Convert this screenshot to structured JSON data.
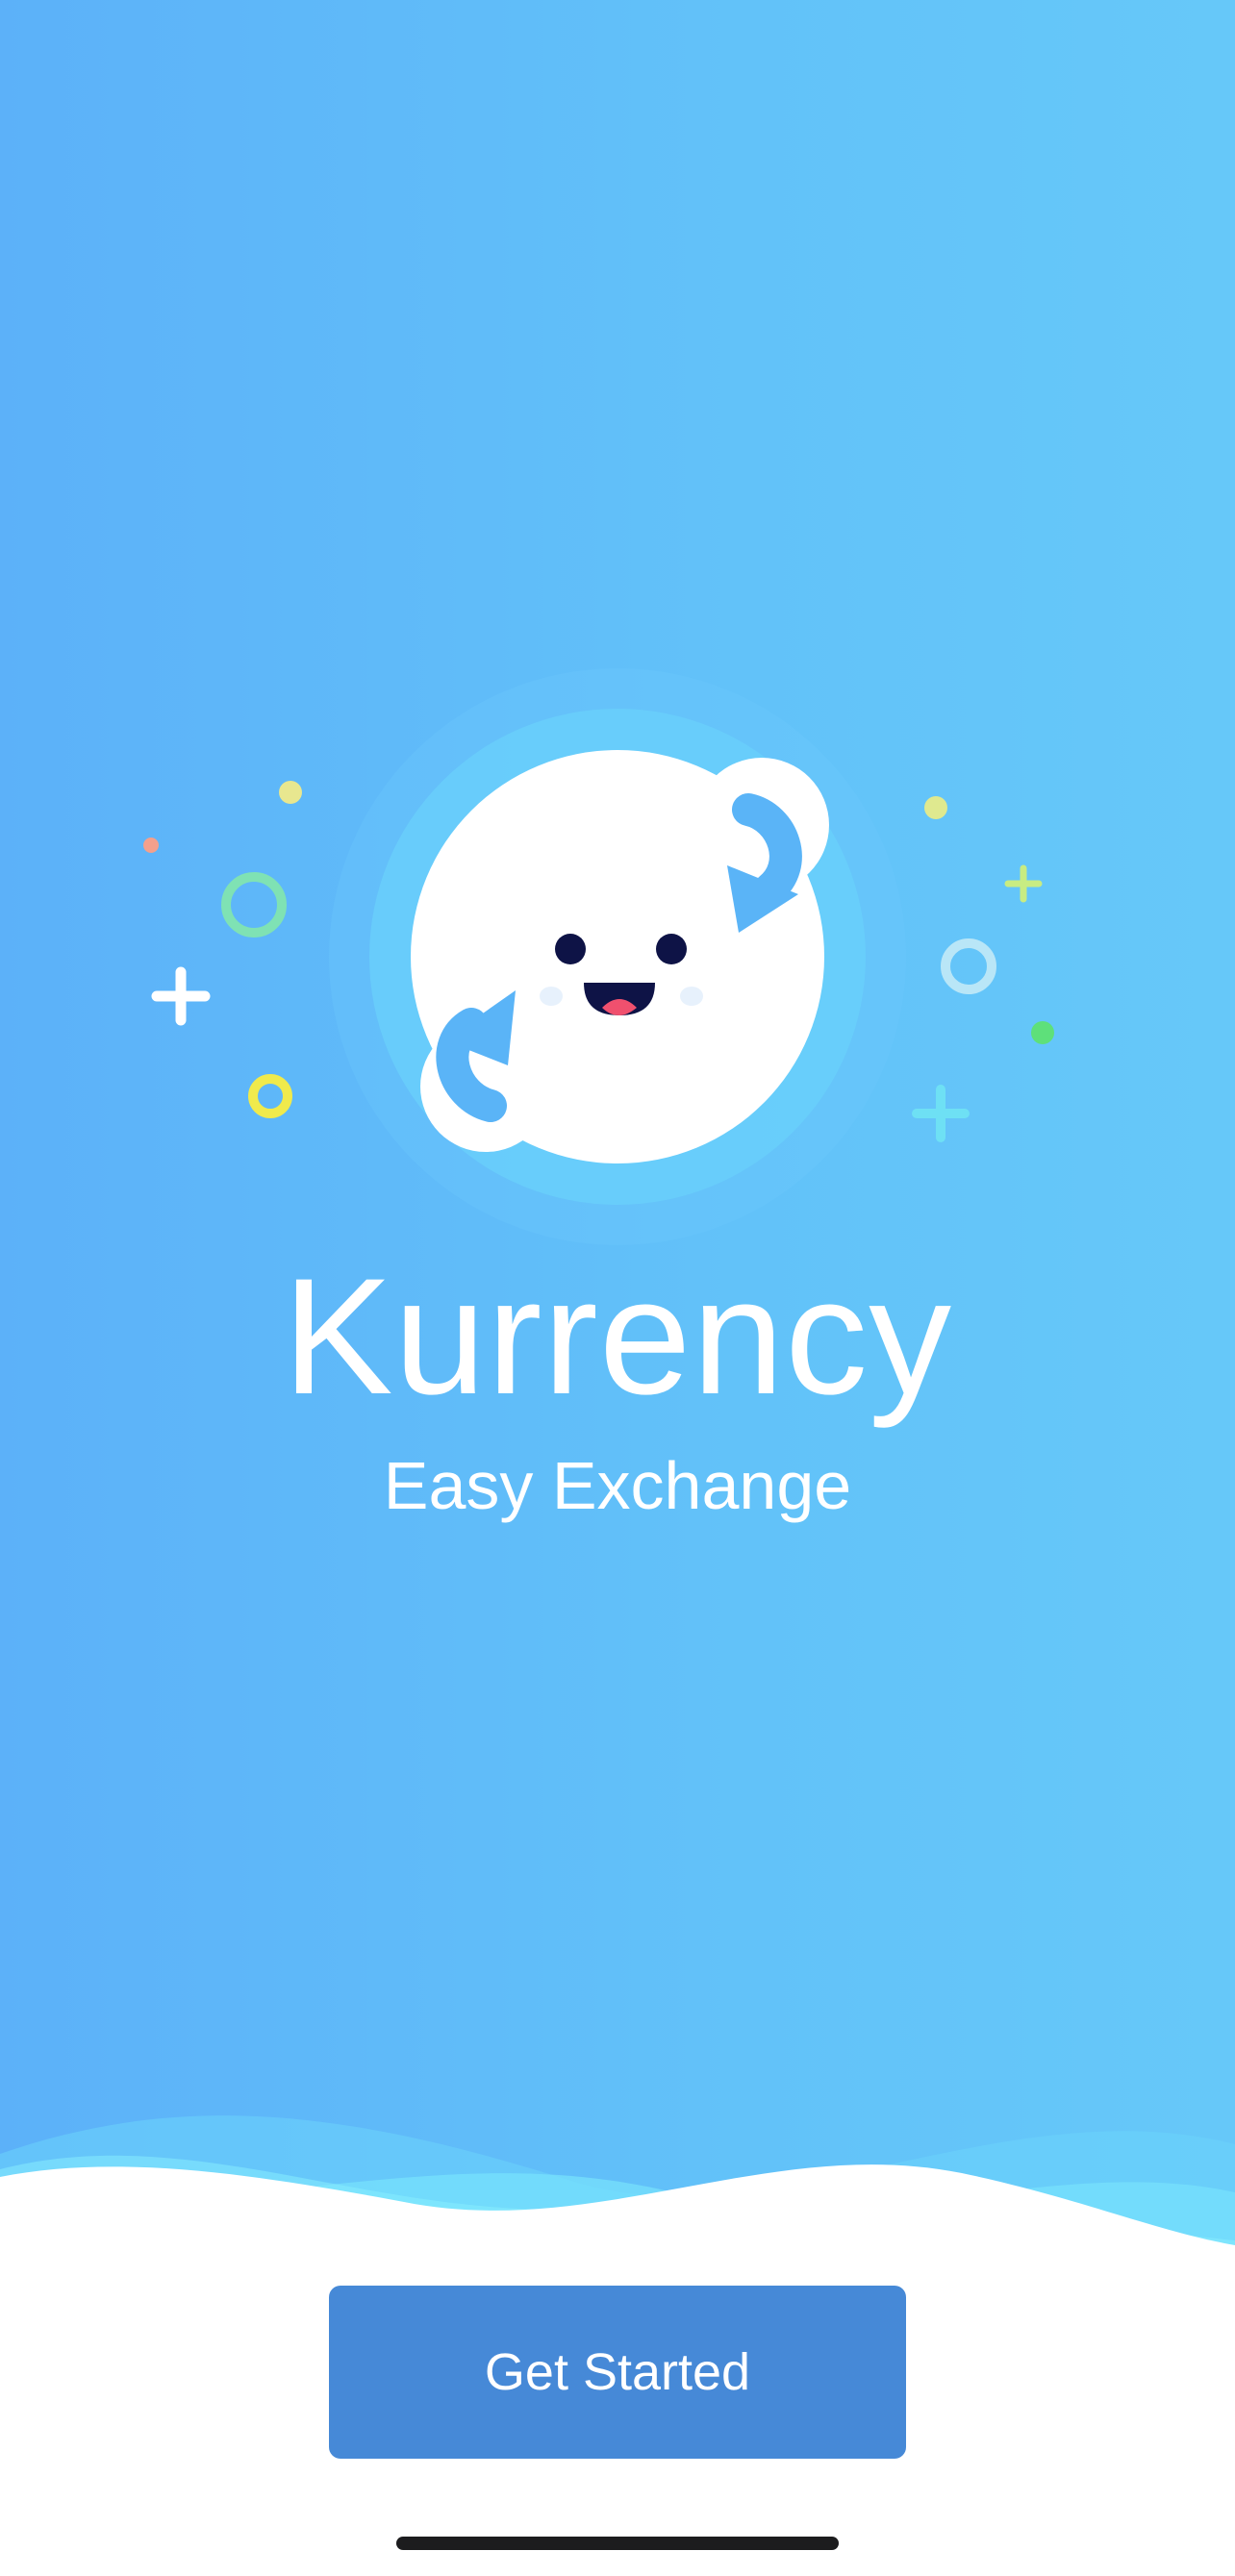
{
  "app": {
    "title": "Kurrency",
    "subtitle": "Easy Exchange"
  },
  "actions": {
    "get_started_label": "Get Started"
  },
  "icons": {
    "mascot": "smiling-globe-exchange-icon",
    "decor_plus": "plus-icon",
    "decor_ring": "ring-icon",
    "decor_dot": "dot-icon"
  },
  "colors": {
    "background_start": "#5cb1f9",
    "background_end": "#66c8f9",
    "button": "#4689d7",
    "mascot_face": "#ffffff",
    "eyes": "#0e1346",
    "tongue": "#f0506e"
  }
}
